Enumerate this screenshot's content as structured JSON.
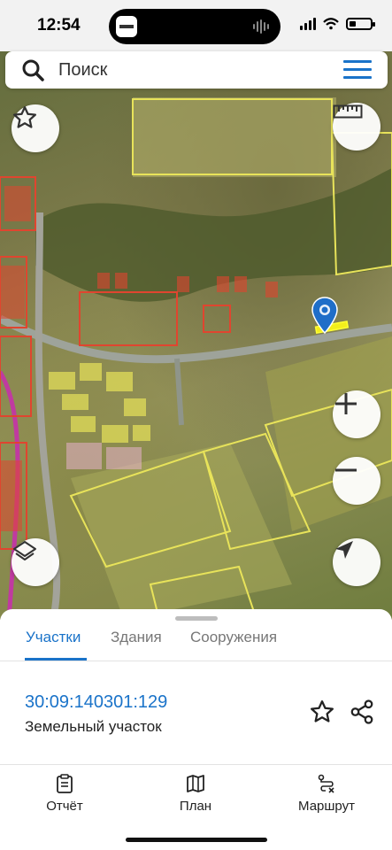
{
  "status_bar": {
    "time": "12:54"
  },
  "search": {
    "placeholder": "Поиск"
  },
  "icons": {
    "search": "search-icon",
    "menu": "hamburger-menu-icon",
    "favorite": "star-icon",
    "ruler": "ruler-icon",
    "zoom_in": "plus-icon",
    "zoom_out": "minus-icon",
    "layers": "layers-icon",
    "locate": "navigation-arrow-icon",
    "marker": "map-pin-icon",
    "share": "share-icon",
    "report": "clipboard-icon",
    "plan": "map-icon",
    "route": "route-icon"
  },
  "colors": {
    "accent": "#1a73c9",
    "parcel_yellow": "#e8e35a",
    "parcel_red": "#e0452f",
    "road_magenta": "#c03aa0"
  },
  "sheet": {
    "tabs": [
      {
        "label": "Участки",
        "active": true
      },
      {
        "label": "Здания",
        "active": false
      },
      {
        "label": "Сооружения",
        "active": false
      }
    ],
    "result": {
      "number": "30:09:140301:129",
      "type": "Земельный участок"
    }
  },
  "bottom_nav": [
    {
      "label": "Отчёт"
    },
    {
      "label": "План"
    },
    {
      "label": "Маршрут"
    }
  ]
}
